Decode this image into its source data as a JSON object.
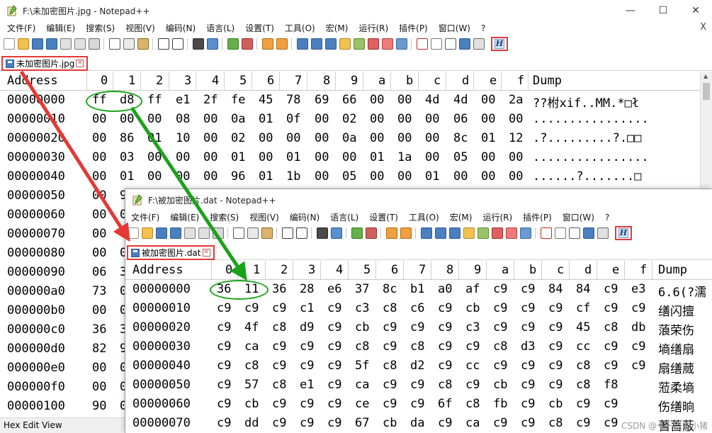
{
  "colors": {
    "red_highlight": "#e53935",
    "green_highlight": "#1aa31a"
  },
  "window1": {
    "title": "F:\\未加密图片.jpg - Notepad++",
    "controls": [
      "—",
      "☐",
      "✕"
    ],
    "menu": [
      "文件(F)",
      "编辑(E)",
      "搜索(S)",
      "视图(V)",
      "编码(N)",
      "语言(L)",
      "设置(T)",
      "工具(O)",
      "宏(M)",
      "运行(R)",
      "插件(P)",
      "窗口(W)",
      "?"
    ],
    "close_x": "X",
    "toolbar_h": "H",
    "tab_label": "未加密图片.jpg",
    "hex_header": {
      "address": "Address",
      "cols": [
        "0",
        "1",
        "2",
        "3",
        "4",
        "5",
        "6",
        "7",
        "8",
        "9",
        "a",
        "b",
        "c",
        "d",
        "e",
        "f"
      ],
      "dump": "Dump"
    },
    "rows": [
      {
        "addr": "00000000",
        "bytes": [
          "ff",
          "d8",
          "ff",
          "e1",
          "2f",
          "fe",
          "45",
          "78",
          "69",
          "66",
          "00",
          "00",
          "4d",
          "4d",
          "00",
          "2a"
        ],
        "dump": "  ??柎xif..MM.*□ł"
      },
      {
        "addr": "00000010",
        "bytes": [
          "00",
          "00",
          "00",
          "08",
          "00",
          "0a",
          "01",
          "0f",
          "00",
          "02",
          "00",
          "00",
          "00",
          "06",
          "00",
          "00"
        ],
        "dump": "................"
      },
      {
        "addr": "00000020",
        "bytes": [
          "00",
          "86",
          "01",
          "10",
          "00",
          "02",
          "00",
          "00",
          "00",
          "0a",
          "00",
          "00",
          "00",
          "8c",
          "01",
          "12"
        ],
        "dump": ".?.........?.□□"
      },
      {
        "addr": "00000030",
        "bytes": [
          "00",
          "03",
          "00",
          "00",
          "00",
          "01",
          "00",
          "01",
          "00",
          "00",
          "01",
          "1a",
          "00",
          "05",
          "00",
          "00"
        ],
        "dump": "................"
      },
      {
        "addr": "00000040",
        "bytes": [
          "00",
          "01",
          "00",
          "00",
          "00",
          "96",
          "01",
          "1b",
          "00",
          "05",
          "00",
          "00",
          "01",
          "00",
          "00",
          "00"
        ],
        "dump": "......?.......□"
      },
      {
        "addr": "00000050",
        "bytes": [
          "00",
          "9"
        ],
        "dump": ""
      },
      {
        "addr": "00000060",
        "bytes": [
          "00",
          "0"
        ],
        "dump": ""
      },
      {
        "addr": "00000070",
        "bytes": [
          "00",
          "0"
        ],
        "dump": ""
      },
      {
        "addr": "00000080",
        "bytes": [
          "00",
          "0"
        ],
        "dump": ""
      },
      {
        "addr": "00000090",
        "bytes": [
          "06",
          "3"
        ],
        "dump": ""
      },
      {
        "addr": "000000a0",
        "bytes": [
          "73",
          "0"
        ],
        "dump": ""
      },
      {
        "addr": "000000b0",
        "bytes": [
          "00",
          "0"
        ],
        "dump": ""
      },
      {
        "addr": "000000c0",
        "bytes": [
          "36",
          "3"
        ],
        "dump": ""
      },
      {
        "addr": "000000d0",
        "bytes": [
          "82",
          "9"
        ],
        "dump": ""
      },
      {
        "addr": "000000e0",
        "bytes": [
          "00",
          "0"
        ],
        "dump": ""
      },
      {
        "addr": "000000f0",
        "bytes": [
          "00",
          "0"
        ],
        "dump": ""
      },
      {
        "addr": "00000100",
        "bytes": [
          "90",
          "0"
        ],
        "dump": ""
      }
    ],
    "status": "Hex Edit View"
  },
  "window2": {
    "title": "F:\\被加密图片.dat - Notepad++",
    "menu": [
      "文件(F)",
      "编辑(E)",
      "搜索(S)",
      "视图(V)",
      "编码(N)",
      "语言(L)",
      "设置(T)",
      "工具(O)",
      "宏(M)",
      "运行(R)",
      "插件(P)",
      "窗口(W)",
      "?"
    ],
    "close_x": "X",
    "toolbar_h": "H",
    "tab_label": "被加密图片.dat",
    "hex_header": {
      "address": "Address",
      "cols": [
        "0",
        "1",
        "2",
        "3",
        "4",
        "5",
        "6",
        "7",
        "8",
        "9",
        "a",
        "b",
        "c",
        "d",
        "e",
        "f"
      ],
      "dump": "Dump"
    },
    "rows": [
      {
        "addr": "00000000",
        "bytes": [
          "36",
          "11",
          "36",
          "28",
          "e6",
          "37",
          "8c",
          "b1",
          "a0",
          "af",
          "c9",
          "c9",
          "84",
          "84",
          "c9",
          "e3"
        ],
        "dump": "6.6(?濡"
      },
      {
        "addr": "00000010",
        "bytes": [
          "c9",
          "c9",
          "c9",
          "c1",
          "c9",
          "c3",
          "c8",
          "c6",
          "c9",
          "cb",
          "c9",
          "c9",
          "c9",
          "cf",
          "c9",
          "c9"
        ],
        "dump": "缮闪擅"
      },
      {
        "addr": "00000020",
        "bytes": [
          "c9",
          "4f",
          "c8",
          "d9",
          "c9",
          "cb",
          "c9",
          "c9",
          "c9",
          "c3",
          "c9",
          "c9",
          "c9",
          "45",
          "c8",
          "db"
        ],
        "dump": "蒗荣伤"
      },
      {
        "addr": "00000030",
        "bytes": [
          "c9",
          "ca",
          "c9",
          "c9",
          "c9",
          "c8",
          "c9",
          "c8",
          "c9",
          "c9",
          "c8",
          "d3",
          "c9",
          "cc",
          "c9",
          "c9"
        ],
        "dump": "墒缮扇"
      },
      {
        "addr": "00000040",
        "bytes": [
          "c9",
          "c8",
          "c9",
          "c9",
          "c9",
          "5f",
          "c8",
          "d2",
          "c9",
          "cc",
          "c9",
          "c9",
          "c9",
          "c8",
          "c9",
          "c9"
        ],
        "dump": "扇缮蒇"
      },
      {
        "addr": "00000050",
        "bytes": [
          "c9",
          "57",
          "c8",
          "e1",
          "c9",
          "ca",
          "c9",
          "c9",
          "c8",
          "c9",
          "cb",
          "c9",
          "c9",
          "c8",
          "f8"
        ],
        "dump": "蒞柔墒"
      },
      {
        "addr": "00000060",
        "bytes": [
          "c9",
          "cb",
          "c9",
          "c9",
          "c9",
          "ce",
          "c9",
          "c9",
          "6f",
          "c8",
          "fb",
          "c9",
          "cb",
          "c9",
          "c9"
        ],
        "dump": "伤缮晌"
      },
      {
        "addr": "00000070",
        "bytes": [
          "c9",
          "dd",
          "c9",
          "c9",
          "c9",
          "67",
          "cb",
          "da",
          "c9",
          "ca",
          "c9",
          "c9",
          "c8",
          "c9",
          "c9"
        ],
        "dump": "蓍蔷蔽"
      }
    ]
  },
  "watermark": "CSDN @十一点的小猪"
}
